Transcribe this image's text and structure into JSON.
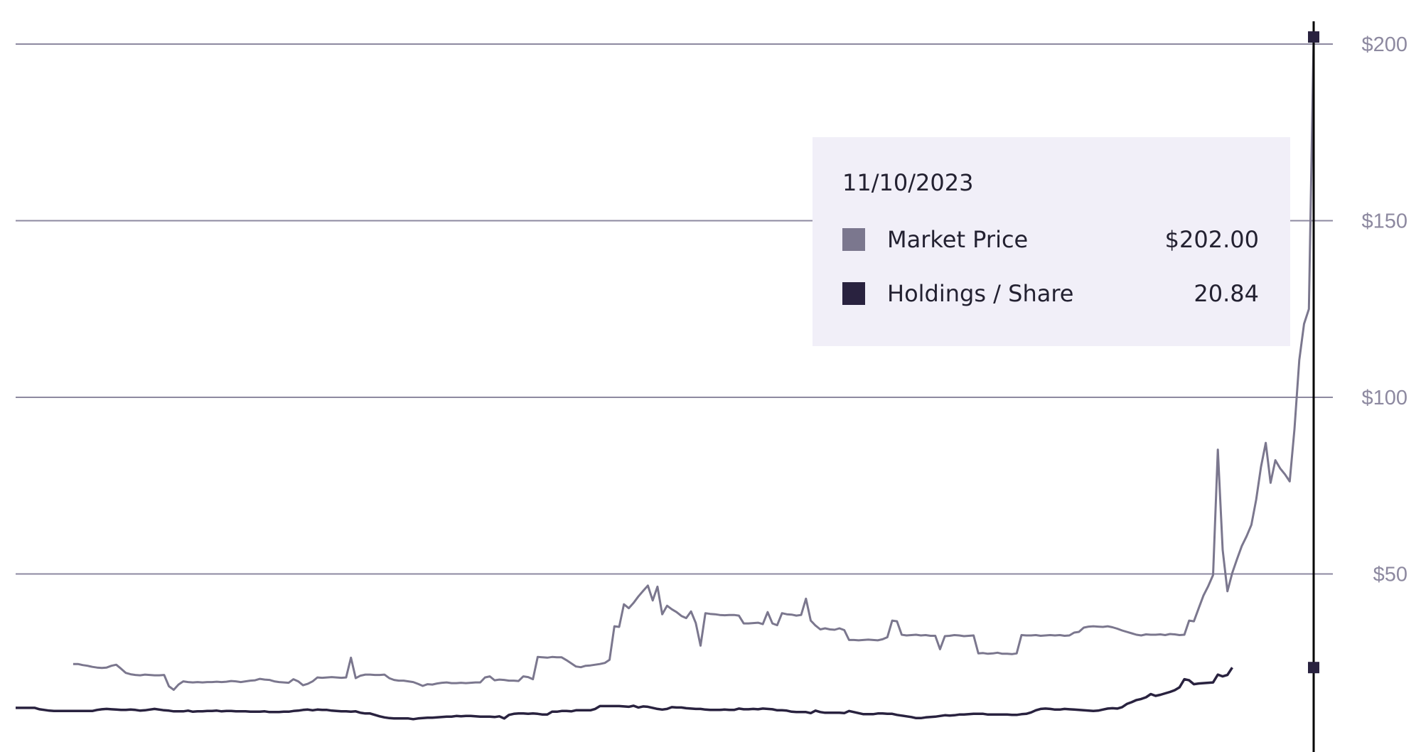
{
  "chart_data": {
    "type": "line",
    "title": "",
    "xlabel": "",
    "ylabel": "",
    "ylim": [
      0,
      200
    ],
    "y_ticks": [
      "$50",
      "$100",
      "$150",
      "$200"
    ],
    "y_tick_values": [
      50,
      100,
      150,
      200
    ],
    "y_axis_position": "right",
    "grid": true,
    "legend": "tooltip",
    "colors": {
      "market_price": "#7b778e",
      "holdings_per_share": "#29223f",
      "grid": "#8d89a0",
      "cursor": "#000000",
      "tooltip_bg": "#f1eff8"
    },
    "series": [
      {
        "name": "Market Price",
        "key": "market_price",
        "start_index": 12,
        "values": [
          24.5,
          24.5,
          24.2,
          24.0,
          23.7,
          23.5,
          23.4,
          23.5,
          24.0,
          24.3,
          23.2,
          22.0,
          21.6,
          21.4,
          21.3,
          21.5,
          21.4,
          21.3,
          21.3,
          21.4,
          18.2,
          17.2,
          18.7,
          19.6,
          19.4,
          19.3,
          19.4,
          19.3,
          19.4,
          19.4,
          19.5,
          19.4,
          19.5,
          19.7,
          19.6,
          19.4,
          19.6,
          19.8,
          19.9,
          20.3,
          20.1,
          20.0,
          19.6,
          19.4,
          19.3,
          19.2,
          20.2,
          19.6,
          18.5,
          18.9,
          19.6,
          20.7,
          20.6,
          20.7,
          20.8,
          20.7,
          20.6,
          20.7,
          26.3,
          20.5,
          21.2,
          21.5,
          21.5,
          21.4,
          21.4,
          21.5,
          20.5,
          20.0,
          19.8,
          19.8,
          19.6,
          19.4,
          18.9,
          18.3,
          18.8,
          18.7,
          19.0,
          19.2,
          19.3,
          19.1,
          19.1,
          19.2,
          19.1,
          19.2,
          19.3,
          19.3,
          20.7,
          21.0,
          19.9,
          20.1,
          20.0,
          19.8,
          19.8,
          19.7,
          21.0,
          20.8,
          20.2,
          26.5,
          26.4,
          26.3,
          26.5,
          26.4,
          26.4,
          25.6,
          24.7,
          23.8,
          23.6,
          24.0,
          24.1,
          24.3,
          24.5,
          24.8,
          25.7,
          35.2,
          35.0,
          41.4,
          40.3,
          41.8,
          43.6,
          45.2,
          46.7,
          42.5,
          46.4,
          38.6,
          41.0,
          40.0,
          39.2,
          38.1,
          37.5,
          39.4,
          36.1,
          29.7,
          38.9,
          38.7,
          38.6,
          38.4,
          38.3,
          38.4,
          38.4,
          38.2,
          36.0,
          36.0,
          36.1,
          36.2,
          35.8,
          39.2,
          36.0,
          35.5,
          38.9,
          38.6,
          38.5,
          38.2,
          38.4,
          43.0,
          36.8,
          35.4,
          34.3,
          34.6,
          34.3,
          34.2,
          34.6,
          34.1,
          31.3,
          31.3,
          31.2,
          31.3,
          31.4,
          31.3,
          31.2,
          31.5,
          32.1,
          36.8,
          36.6,
          32.8,
          32.6,
          32.7,
          32.8,
          32.6,
          32.7,
          32.5,
          32.5,
          28.7,
          32.4,
          32.5,
          32.7,
          32.6,
          32.4,
          32.5,
          32.6,
          27.5,
          27.6,
          27.4,
          27.5,
          27.7,
          27.4,
          27.4,
          27.3,
          27.5,
          32.7,
          32.6,
          32.6,
          32.7,
          32.5,
          32.6,
          32.7,
          32.6,
          32.7,
          32.5,
          32.6,
          33.4,
          33.6,
          34.8,
          35.1,
          35.2,
          35.1,
          35.0,
          35.2,
          34.9,
          34.5,
          34.0,
          33.6,
          33.2,
          32.8,
          32.6,
          32.9,
          32.8,
          32.8,
          32.9,
          32.7,
          33.0,
          32.9,
          32.7,
          32.8,
          36.8,
          36.6,
          40.3,
          43.9,
          46.6,
          49.7,
          85.2,
          56.8,
          45.1,
          50.3,
          54.2,
          57.9,
          60.7,
          63.9,
          71.0,
          80.3,
          87.1,
          75.8,
          82.2,
          79.9,
          78.2,
          76.2,
          91.0,
          110.6,
          120.8,
          125.0,
          202.0
        ]
      },
      {
        "name": "Holdings / Share",
        "key": "holdings_per_share",
        "start_index": 0,
        "values": [
          12.1,
          12.1,
          12.1,
          12.1,
          12.1,
          11.7,
          11.5,
          11.3,
          11.2,
          11.2,
          11.2,
          11.2,
          11.2,
          11.2,
          11.2,
          11.2,
          11.2,
          11.5,
          11.7,
          11.8,
          11.7,
          11.6,
          11.5,
          11.5,
          11.6,
          11.5,
          11.3,
          11.4,
          11.6,
          11.8,
          11.6,
          11.4,
          11.3,
          11.1,
          11.1,
          11.1,
          11.3,
          11.0,
          11.1,
          11.1,
          11.2,
          11.2,
          11.3,
          11.1,
          11.2,
          11.2,
          11.1,
          11.1,
          11.1,
          11.0,
          11.0,
          11.0,
          11.1,
          10.9,
          10.9,
          10.9,
          11.0,
          11.0,
          11.2,
          11.3,
          11.5,
          11.6,
          11.4,
          11.6,
          11.5,
          11.5,
          11.3,
          11.2,
          11.1,
          11.1,
          11.0,
          11.1,
          10.7,
          10.5,
          10.5,
          10.1,
          9.7,
          9.4,
          9.2,
          9.1,
          9.1,
          9.1,
          9.1,
          8.9,
          9.1,
          9.2,
          9.3,
          9.3,
          9.4,
          9.5,
          9.6,
          9.6,
          9.8,
          9.7,
          9.8,
          9.8,
          9.7,
          9.6,
          9.6,
          9.6,
          9.5,
          9.7,
          9.1,
          10.1,
          10.4,
          10.5,
          10.5,
          10.4,
          10.5,
          10.4,
          10.2,
          10.2,
          11.0,
          11.0,
          11.2,
          11.2,
          11.1,
          11.4,
          11.4,
          11.4,
          11.4,
          11.8,
          12.6,
          12.6,
          12.6,
          12.6,
          12.6,
          12.5,
          12.4,
          12.7,
          12.2,
          12.5,
          12.4,
          12.1,
          11.8,
          11.6,
          11.8,
          12.3,
          12.2,
          12.2,
          12.0,
          11.9,
          11.8,
          11.8,
          11.6,
          11.5,
          11.5,
          11.5,
          11.6,
          11.5,
          11.5,
          11.9,
          11.7,
          11.7,
          11.8,
          11.7,
          11.9,
          11.8,
          11.7,
          11.4,
          11.4,
          11.3,
          11.0,
          10.9,
          10.9,
          10.9,
          10.6,
          11.3,
          10.9,
          10.7,
          10.7,
          10.7,
          10.7,
          10.6,
          11.2,
          10.9,
          10.6,
          10.3,
          10.3,
          10.3,
          10.5,
          10.5,
          10.4,
          10.4,
          10.1,
          9.9,
          9.7,
          9.5,
          9.2,
          9.2,
          9.4,
          9.5,
          9.6,
          9.8,
          10.0,
          9.9,
          10.0,
          10.2,
          10.2,
          10.3,
          10.4,
          10.4,
          10.4,
          10.2,
          10.2,
          10.2,
          10.2,
          10.2,
          10.1,
          10.1,
          10.3,
          10.4,
          10.8,
          11.4,
          11.8,
          11.9,
          11.8,
          11.6,
          11.6,
          11.8,
          11.7,
          11.6,
          11.5,
          11.4,
          11.3,
          11.2,
          11.3,
          11.6,
          11.9,
          12.0,
          11.9,
          12.3,
          13.2,
          13.7,
          14.3,
          14.6,
          15.1,
          16.0,
          15.5,
          15.8,
          16.2,
          16.6,
          17.1,
          17.9,
          20.2,
          19.9,
          18.8,
          19.0,
          19.1,
          19.2,
          19.3,
          21.5,
          21.0,
          21.4,
          23.5
        ]
      }
    ],
    "tooltip": {
      "date": "11/10/2023",
      "rows": [
        {
          "label": "Market Price",
          "value": "$202.00"
        },
        {
          "label": "Holdings / Share",
          "value": "20.84"
        }
      ]
    }
  }
}
